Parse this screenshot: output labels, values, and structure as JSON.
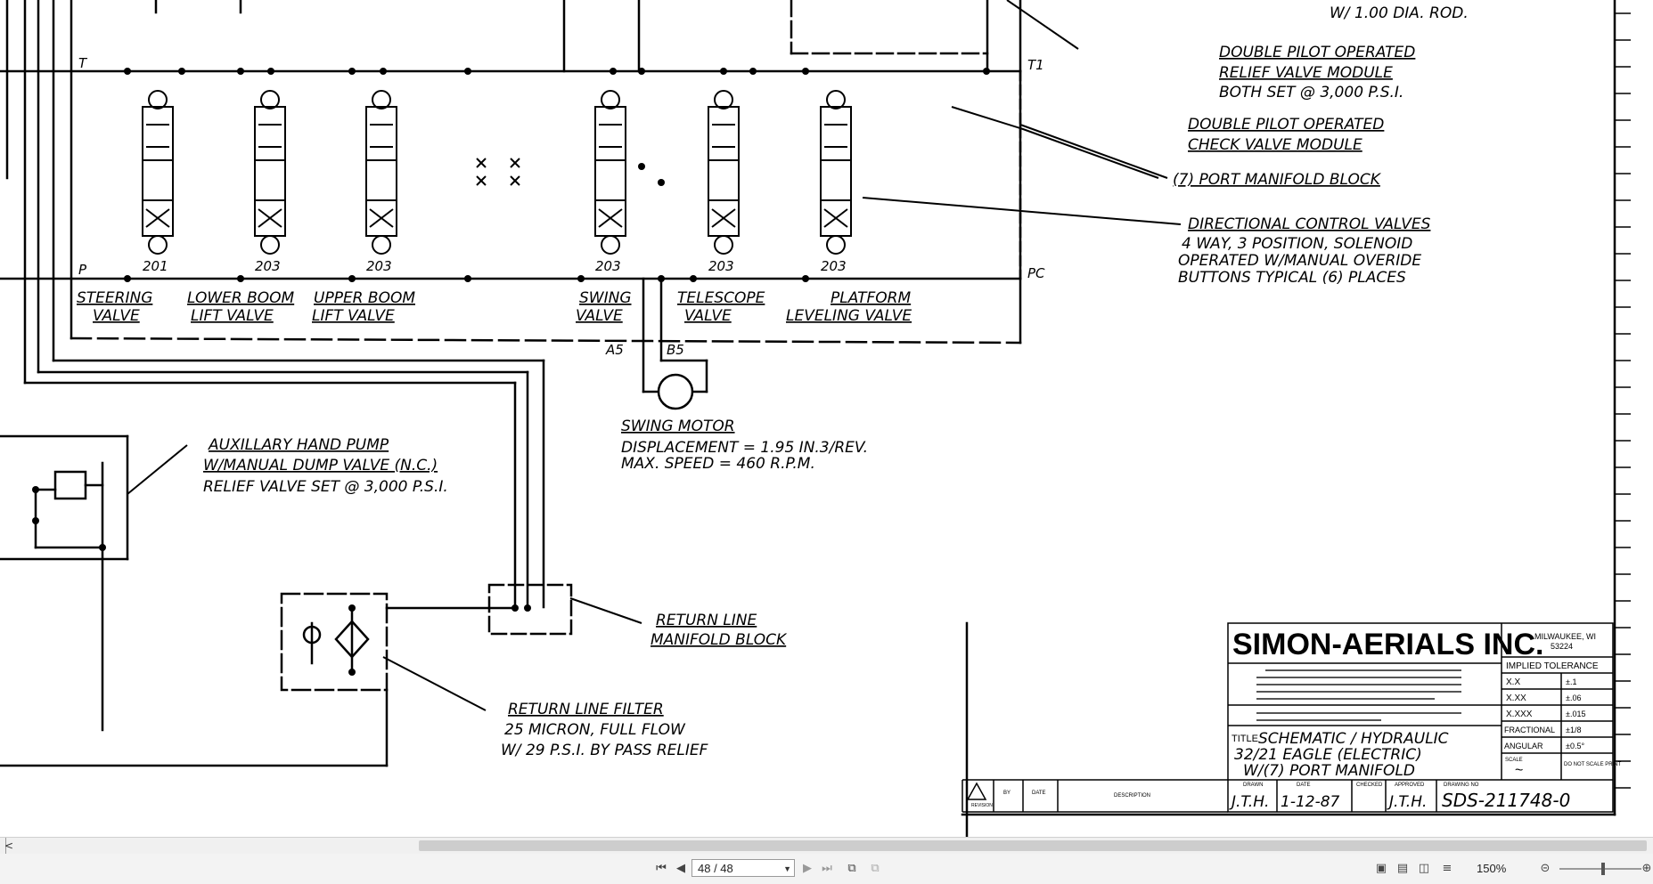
{
  "drawing": {
    "valves": [
      {
        "number": "201",
        "name_line1": "STEERING",
        "name_line2": "VALVE"
      },
      {
        "number": "203",
        "name_line1": "LOWER BOOM",
        "name_line2": "LIFT VALVE"
      },
      {
        "number": "203",
        "name_line1": "UPPER BOOM",
        "name_line2": "LIFT VALVE"
      },
      {
        "number": "203",
        "name_line1": "SWING",
        "name_line2": "VALVE"
      },
      {
        "number": "203",
        "name_line1": "TELESCOPE",
        "name_line2": "VALVE"
      },
      {
        "number": "203",
        "name_line1": "PLATFORM",
        "name_line2": "LEVELING VALVE"
      }
    ],
    "ports": {
      "t": "T",
      "p": "P",
      "t1": "T1",
      "pc": "PC",
      "a5": "A5",
      "b5": "B5"
    },
    "top_rod_note": "W/ 1.00 DIA. ROD.",
    "callouts": {
      "relief_module": {
        "line1": "DOUBLE PILOT OPERATED",
        "line2": "RELIEF VALVE MODULE",
        "line3": "BOTH SET @ 3,000 P.S.I."
      },
      "check_module": {
        "line1": "DOUBLE PILOT OPERATED",
        "line2": "CHECK VALVE MODULE"
      },
      "manifold_block": {
        "line1": "(7) PORT MANIFOLD BLOCK"
      },
      "directional_valves": {
        "line1": "DIRECTIONAL CONTROL VALVES",
        "line2": "4 WAY, 3 POSITION, SOLENOID",
        "line3": "OPERATED W/MANUAL OVERIDE",
        "line4": "BUTTONS TYPICAL (6) PLACES"
      },
      "swing_motor": {
        "line1": "SWING MOTOR",
        "line2": "DISPLACEMENT = 1.95 IN.3/REV.",
        "line3": "MAX. SPEED = 460 R.P.M."
      },
      "aux_pump": {
        "line1": "AUXILLARY HAND PUMP",
        "line2": "W/MANUAL DUMP VALVE (N.C.)",
        "line3": "RELIEF VALVE SET @ 3,000 P.S.I."
      },
      "return_manifold": {
        "line1": "RETURN LINE",
        "line2": "MANIFOLD BLOCK"
      },
      "return_filter": {
        "line1": "RETURN LINE FILTER",
        "line2": "25 MICRON, FULL FLOW",
        "line3": "W/ 29 P.S.I. BY PASS RELIEF"
      }
    },
    "title_block": {
      "company": "SIMON-AERIALS INC.",
      "city": "MILWAUKEE, WI",
      "zip": "53224",
      "tolerance_header": "IMPLIED TOLERANCE",
      "tolerances": [
        {
          "label": "X.X",
          "value": "±.1"
        },
        {
          "label": "X.XX",
          "value": "±.06"
        },
        {
          "label": "X.XXX",
          "value": "±.015"
        },
        {
          "label": "FRACTIONAL",
          "value": "±1/8"
        },
        {
          "label": "ANGULAR",
          "value": "±0.5°"
        }
      ],
      "scale_label": "SCALE",
      "scale_value": "~",
      "no_scale_note": "DO NOT SCALE PRINT",
      "title_label": "TITLE",
      "title_line1": "SCHEMATIC / HYDRAULIC",
      "title_line2": "32/21 EAGLE (ELECTRIC)",
      "title_line3": "W/(7) PORT MANIFOLD",
      "drawn_label": "DRAWN",
      "date_label": "DATE",
      "checked_label": "CHECKED",
      "approved_label": "APPROVED",
      "drawing_no_label": "DRAWING NO",
      "drawn_by": "J.T.H.",
      "date": "1-12-87",
      "approved_by": "J.T.H.",
      "drawing_no": "SDS-211748-0",
      "revision_label": "REVISION",
      "by_label": "BY",
      "rev_date_label": "DATE",
      "description_label": "DESCRIPTION"
    }
  },
  "viewer": {
    "page_indicator": "48 / 48",
    "zoom_level": "150%",
    "scroll_left_glyph": "<"
  }
}
